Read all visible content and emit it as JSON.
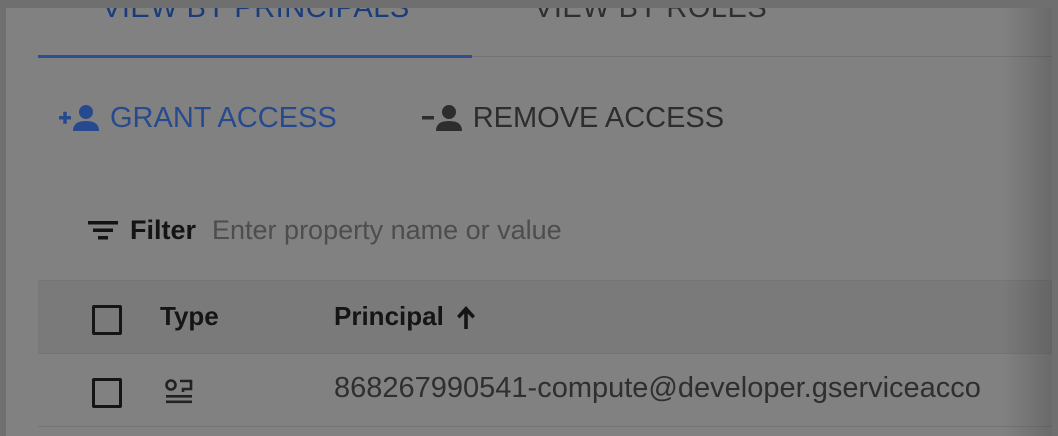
{
  "tabs": [
    {
      "label": "View by principals",
      "active": true
    },
    {
      "label": "View by roles",
      "active": false
    }
  ],
  "actions": {
    "grant_label": "Grant access",
    "remove_label": "Remove access"
  },
  "filter": {
    "label": "Filter",
    "placeholder": "Enter property name or value"
  },
  "table": {
    "columns": {
      "type": "Type",
      "principal": "Principal"
    },
    "rows": [
      {
        "type_icon": "service-account-icon",
        "principal": "868267990541-compute@developer.gserviceacco"
      }
    ]
  },
  "colors": {
    "accent": "#274a8e",
    "overlay_background": "#818181"
  },
  "icons": {
    "grant": "person-add-icon",
    "remove": "person-remove-icon",
    "filter": "filter-list-icon",
    "sort": "arrow-up-icon",
    "row_type": "service-account-icon"
  }
}
